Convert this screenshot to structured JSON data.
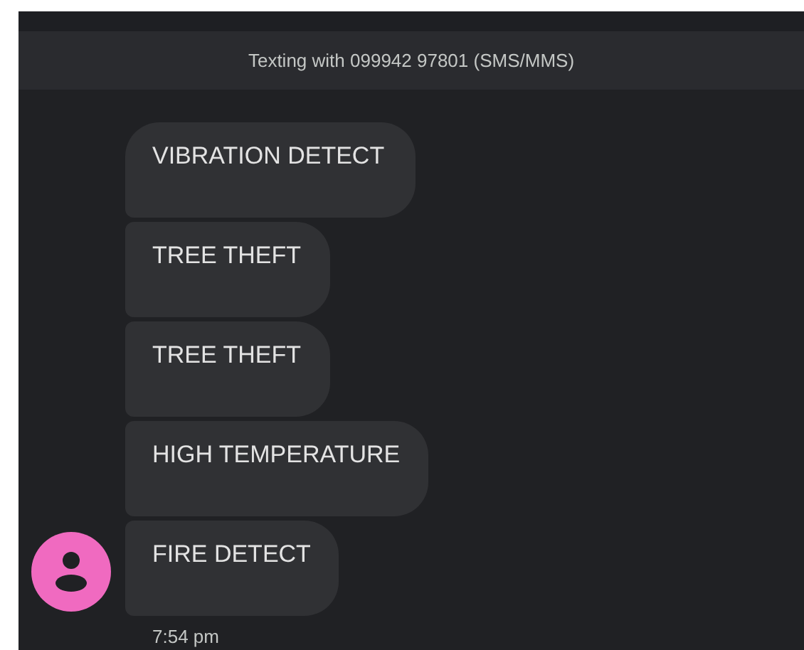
{
  "header": {
    "title": "Texting with 099942 97801 (SMS/MMS)"
  },
  "messages": [
    {
      "text": "VIBRATION DETECT"
    },
    {
      "text": "TREE THEFT"
    },
    {
      "text": "TREE THEFT"
    },
    {
      "text": "HIGH TEMPERATURE"
    },
    {
      "text": "FIRE DETECT"
    }
  ],
  "avatar": {
    "color": "#f06ac0"
  },
  "timestamp": "7:54 pm"
}
